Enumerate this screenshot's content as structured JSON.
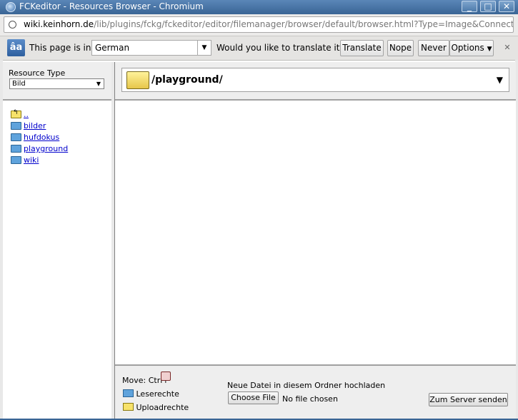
{
  "window": {
    "title": "FCKeditor - Resources Browser - Chromium",
    "minimize": "_",
    "maximize": "□",
    "close": "✕"
  },
  "address": {
    "host": "wiki.keinhorn.de",
    "path": "/lib/plugins/fckg/fckeditor/editor/filemanager/browser/default/browser.html?Type=Image&Connector=http"
  },
  "translate_bar": {
    "icon_text": "âa",
    "prefix": "This page is in",
    "language": "German",
    "question": "Would you like to translate it?",
    "translate": "Translate",
    "nope": "Nope",
    "never": "Never translate German",
    "options": "Options",
    "options_arrow": "▼",
    "close": "✕"
  },
  "sidebar": {
    "resource_type_label": "Resource Type",
    "resource_type_value": "Bild",
    "select_arrow": "▼",
    "folders": [
      {
        "label": "..",
        "type": "up"
      },
      {
        "label": "bilder",
        "type": "folder"
      },
      {
        "label": "hufdokus",
        "type": "folder"
      },
      {
        "label": "playground",
        "type": "folder"
      },
      {
        "label": "wiki",
        "type": "folder"
      }
    ]
  },
  "main": {
    "current_path": "/playground/",
    "path_arrow": "▼"
  },
  "bottom": {
    "move_label": "Move: Ctrl+",
    "read_rights": "Leserechte",
    "upload_rights": "Uploadrechte",
    "upload_label": "Neue Datei in diesem Ordner hochladen",
    "choose_file": "Choose File",
    "no_file": "No file chosen",
    "send": "Zum Server senden"
  },
  "colors": {
    "titlebar": "#3a6595",
    "link": "#0000cc",
    "panel_bg": "#eeeeee"
  }
}
